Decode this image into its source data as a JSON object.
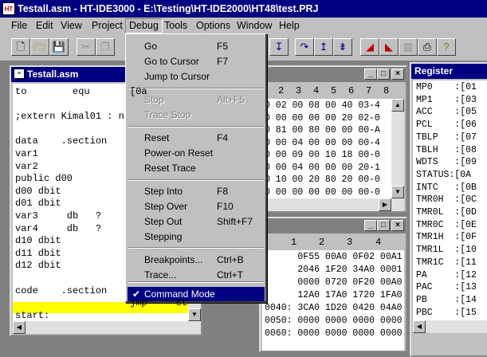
{
  "app": {
    "title": "Testall.asm - HT-IDE3000 - E:\\Testing\\HT-IDE2000\\HT48\\test.PRJ",
    "icon_label": "HT"
  },
  "menubar": {
    "items": [
      "File",
      "Edit",
      "View",
      "Project",
      "Debug",
      "Tools",
      "Options",
      "Window",
      "Help"
    ]
  },
  "toolbar": {
    "buttons": [
      "new-icon",
      "open-icon",
      "save-icon",
      "cut-icon",
      "copy-icon",
      "paste-icon",
      "step-into-icon",
      "step-over-icon",
      "step-out-icon",
      "step-icon",
      "breakpoint-icon",
      "breakpoint-clear-icon",
      "trace-icon",
      "print-icon",
      "help-icon"
    ]
  },
  "debug_menu": {
    "items": [
      {
        "label": "Go",
        "shortcut": "F5",
        "enabled": true
      },
      {
        "label": "Go to Cursor",
        "shortcut": "F7",
        "enabled": true
      },
      {
        "label": "Jump to Cursor",
        "shortcut": "",
        "enabled": true
      },
      {
        "label": "Stop",
        "shortcut": "Alt+F5",
        "enabled": false
      },
      {
        "label": "Trace Stop",
        "shortcut": "",
        "enabled": false
      },
      {
        "label": "Reset",
        "shortcut": "F4",
        "enabled": true
      },
      {
        "label": "Power-on Reset",
        "shortcut": "",
        "enabled": true
      },
      {
        "label": "Reset Trace",
        "shortcut": "",
        "enabled": true
      },
      {
        "label": "Step Into",
        "shortcut": "F8",
        "enabled": true
      },
      {
        "label": "Step Over",
        "shortcut": "F10",
        "enabled": true
      },
      {
        "label": "Step Out",
        "shortcut": "Shift+F7",
        "enabled": true
      },
      {
        "label": "Stepping",
        "shortcut": "",
        "enabled": true
      },
      {
        "label": "Breakpoints...",
        "shortcut": "Ctrl+B",
        "enabled": true
      },
      {
        "label": "Trace...",
        "shortcut": "Ctrl+T",
        "enabled": true
      },
      {
        "label": "Command Mode",
        "shortcut": "",
        "enabled": true,
        "checked": true
      }
    ]
  },
  "source_window": {
    "title": "Testall.asm",
    "lines": [
      "to        equ       [0a",
      "",
      ";extern Kimal01 : n",
      "",
      "data    .section",
      "var1",
      "var2",
      "public d00",
      "d00 dbit",
      "d01 dbit",
      "var3     db   ?",
      "var4     db   ?",
      "d10 dbit",
      "d11 dbit",
      "d12 dbit",
      "",
      "code    .section",
      "                    jmp     start",
      "start:"
    ]
  },
  "ram_window": {
    "header_cols": [
      "2",
      "3",
      "4",
      "5",
      "6",
      "7",
      "8"
    ],
    "rows": [
      "0 02 00 08 00 40 03-4",
      "0 00 00 00 00 20 02-0",
      "0 81 00 80 00 00 00-A",
      "0 00 04 00 00 00 00-4",
      "0 00 09 00 10 18 00-0",
      "0 00 04 00 00 00 20-1",
      "0 10 00 20 80 20 00-0",
      "0 00 00 00 00 00 00-0"
    ]
  },
  "program_window": {
    "header_cols": [
      "1",
      "2",
      "3",
      "4"
    ],
    "rows": [
      "      0F55 00A0 0F02 00A1",
      "      2046 1F20 34A0 0001",
      "      0000 0720 0F20 00A0",
      "      12A0 17A0 1720 1FA0",
      "0040: 3CA0 1D20 0420 04A0 0C20",
      "0050: 0000 0000 0000 0000",
      "0060: 0000 0000 0000 0000"
    ]
  },
  "register_window": {
    "title": "Register",
    "rows": [
      "MP0    :[01",
      "MP1    :[03",
      "ACC    :[05",
      "PCL    :[06",
      "TBLP   :[07",
      "TBLH   :[08",
      "WDTS   :[09",
      "STATUS:[0A",
      "INTC   :[0B",
      "TMR0H  :[0C",
      "TMR0L  :[0D",
      "TMR0C  :[0E",
      "TMR1H  :[0F",
      "TMR1L  :[10",
      "TMR1C  :[11",
      "PA     :[12",
      "PAC    :[13",
      "PB     :[14",
      "PBC    :[15"
    ]
  },
  "colors": {
    "title_active": "#000080",
    "current_line": "#ffff00",
    "face": "#c0c0c0"
  }
}
